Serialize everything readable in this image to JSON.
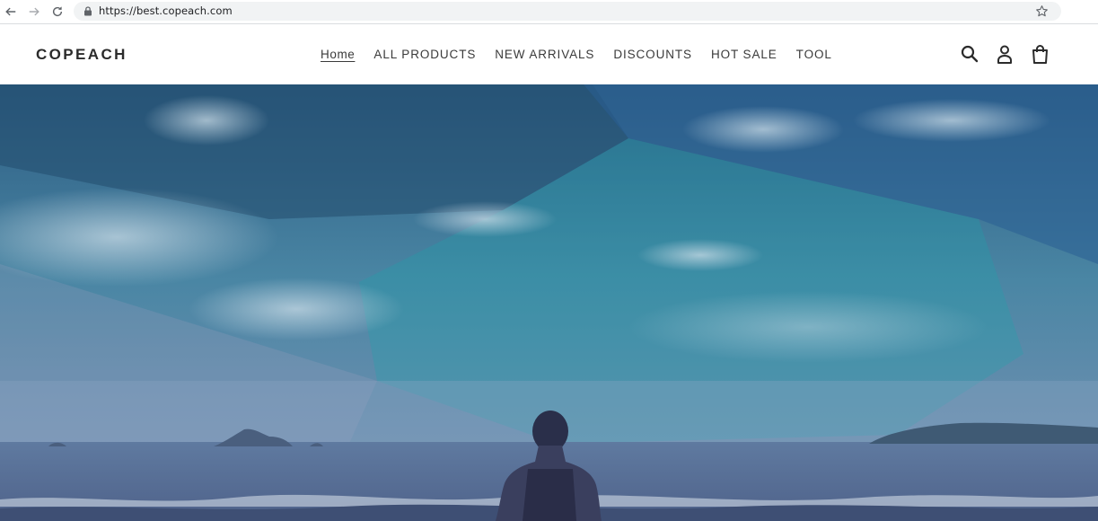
{
  "browser": {
    "url": "https://best.copeach.com",
    "icons": [
      "back-arrow-icon",
      "forward-arrow-icon",
      "reload-icon",
      "lock-icon",
      "bookmark-star-icon"
    ]
  },
  "header": {
    "logo": "COPEACH",
    "nav": [
      {
        "label": "Home",
        "active": true
      },
      {
        "label": "ALL PRODUCTS",
        "active": false
      },
      {
        "label": "NEW ARRIVALS",
        "active": false
      },
      {
        "label": "DISCOUNTS",
        "active": false
      },
      {
        "label": "HOT SALE",
        "active": false
      },
      {
        "label": "TOOL",
        "active": false
      }
    ],
    "icons": [
      "search-icon",
      "account-icon",
      "cart-icon"
    ]
  },
  "hero": {
    "image": "person-meditating-at-beach-icon",
    "colors": {
      "sky_top": "#2f5f84",
      "sky_mid": "#4b83a0",
      "sea": "#5a6f95",
      "overlay": "#1b9ea8"
    }
  }
}
